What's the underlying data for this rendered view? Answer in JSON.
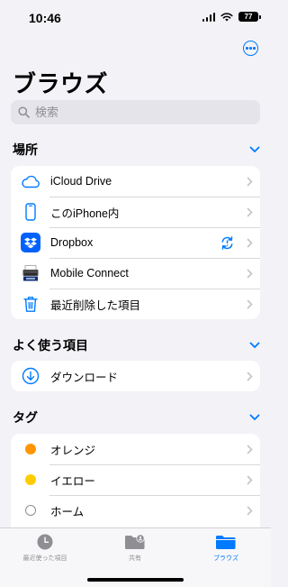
{
  "status_bar": {
    "time": "10:46",
    "battery": "77"
  },
  "header": {
    "title": "ブラウズ",
    "more_icon": "ellipsis-circle-icon"
  },
  "search": {
    "placeholder": "検索"
  },
  "sections": {
    "locations": {
      "title": "場所",
      "items": [
        {
          "label": "iCloud Drive",
          "icon": "icloud-icon"
        },
        {
          "label": "このiPhone内",
          "icon": "iphone-icon"
        },
        {
          "label": "Dropbox",
          "icon": "dropbox-icon"
        },
        {
          "label": "Mobile Connect",
          "icon": "brother-printer-icon"
        },
        {
          "label": "最近削除した項目",
          "icon": "trash-icon"
        }
      ]
    },
    "favorites": {
      "title": "よく使う項目",
      "items": [
        {
          "label": "ダウンロード",
          "icon": "download-icon"
        }
      ]
    },
    "tags": {
      "title": "タグ",
      "items": [
        {
          "label": "オレンジ",
          "color": "#ff9500"
        },
        {
          "label": "イエロー",
          "color": "#ffcc00"
        },
        {
          "label": "ホーム",
          "color": "#ffffff"
        }
      ]
    }
  },
  "tab_bar": {
    "tabs": [
      {
        "label": "最近使った項目",
        "icon": "clock-icon",
        "active": false
      },
      {
        "label": "共有",
        "icon": "shared-folder-icon",
        "active": false
      },
      {
        "label": "ブラウズ",
        "icon": "folder-icon",
        "active": true
      }
    ]
  },
  "colors": {
    "accent": "#007aff",
    "background": "#f2f2f7",
    "dropbox": "#0061fe"
  }
}
